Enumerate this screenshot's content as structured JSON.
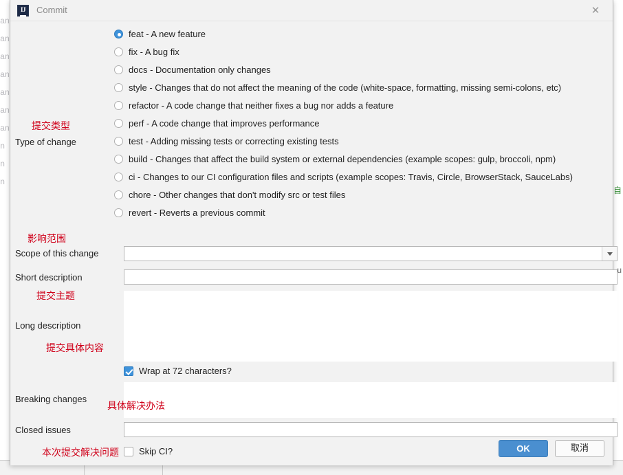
{
  "background": {
    "left_fragments": [
      "an",
      "an",
      "an",
      "an",
      "an",
      "an",
      "an",
      "n",
      "n",
      "n"
    ],
    "right_glyph_green": "自",
    "right_glyph_gray": "u"
  },
  "dialog": {
    "title": "Commit",
    "app_icon": "intellij-idea-icon",
    "close_icon": "close-icon"
  },
  "type_of_change": {
    "label": "Type of change",
    "cn_note": "提交类型",
    "selected_index": 0,
    "options": [
      "feat - A new feature",
      "fix - A bug fix",
      "docs - Documentation only changes",
      "style - Changes that do not affect the meaning of the code (white-space, formatting, missing semi-colons, etc)",
      "refactor - A code change that neither fixes a bug nor adds a feature",
      "perf - A code change that improves performance",
      "test - Adding missing tests or correcting existing tests",
      "build - Changes that affect the build system or external dependencies (example scopes: gulp, broccoli, npm)",
      "ci - Changes to our CI configuration files and scripts (example scopes: Travis, Circle, BrowserStack, SauceLabs)",
      "chore - Other changes that don't modify src or test files",
      "revert - Reverts a previous commit"
    ]
  },
  "scope": {
    "label": "Scope of this change",
    "cn_note": "影响范围",
    "value": "",
    "placeholder": "",
    "dropdown_icon": "chevron-down-icon"
  },
  "short_description": {
    "label": "Short description",
    "cn_note": "提交主题",
    "value": "",
    "placeholder": ""
  },
  "long_description": {
    "label": "Long description",
    "cn_note": "提交具体内容",
    "value": "",
    "placeholder": ""
  },
  "wrap_checkbox": {
    "label": "Wrap at 72 characters?",
    "checked": true
  },
  "breaking_changes": {
    "label": "Breaking changes",
    "cn_note": "具体解决办法",
    "value": "",
    "placeholder": ""
  },
  "closed_issues": {
    "label": "Closed issues",
    "cn_note": "本次提交解决问题",
    "value": "",
    "placeholder": ""
  },
  "skip_ci_checkbox": {
    "label": "Skip CI?",
    "checked": false
  },
  "buttons": {
    "ok": "OK",
    "cancel": "取消"
  },
  "colors": {
    "accent": "#4a8fd0",
    "radio_selected": "#3f93db",
    "note_red": "#d0021b",
    "dialog_bg": "#f2f2f2"
  }
}
